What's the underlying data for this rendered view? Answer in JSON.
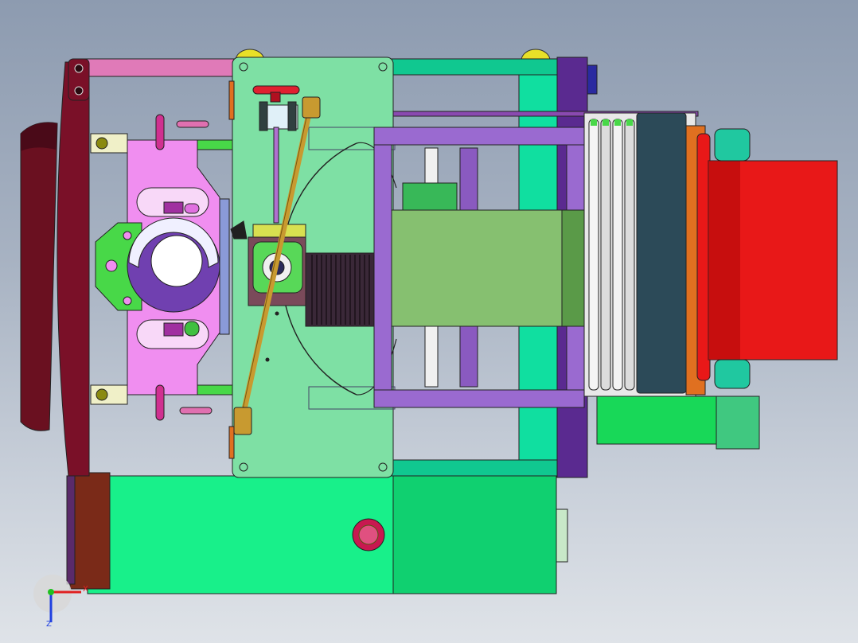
{
  "viewport": {
    "background_top": "#8d9bb0",
    "background_bottom": "#dfe3e8"
  },
  "axis_triad": {
    "x_label": "X",
    "z_label": "Z",
    "x_color": "#e02020",
    "y_color": "#20c020",
    "z_color": "#2040e0"
  },
  "colors": {
    "frame_maroon": "#7a1028",
    "pink_bar": "#e07ab8",
    "magenta_block": "#f08ef0",
    "green_arm": "#48d848",
    "mint_plate": "#7ee0a4",
    "base_green": "#18f08a",
    "base_green_dark": "#10d070",
    "teal_rails": "#10c890",
    "purple_frame": "#9a6ad0",
    "olive_belt": "#86c070",
    "motor_dark": "#3a2838",
    "gold_rod": "#c89a30",
    "red_roll": "#e81818",
    "cyan_shaft": "#20c8a0",
    "slate_plate": "#2c4a58",
    "brown_box": "#7a2a18",
    "yellow_knob": "#e8e028",
    "crimson_knob": "#c81850"
  }
}
